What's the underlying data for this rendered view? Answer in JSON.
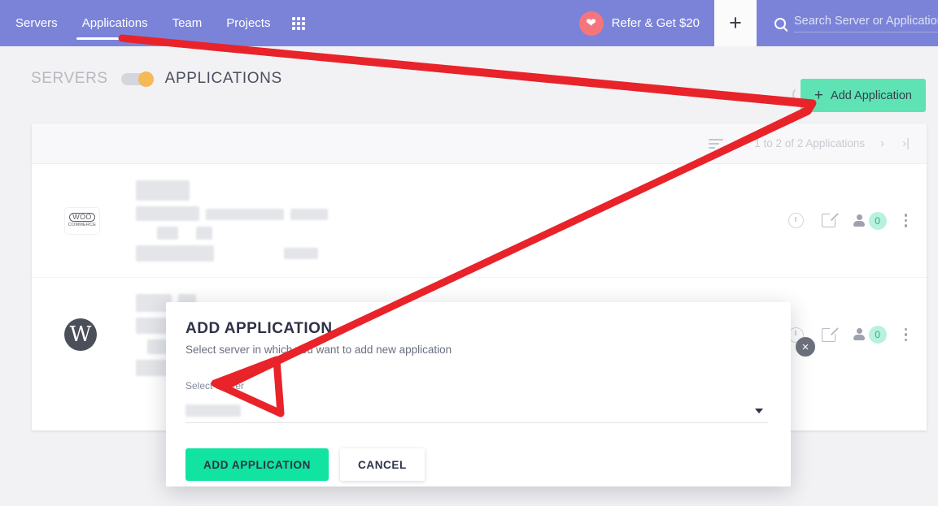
{
  "topnav": {
    "items": [
      {
        "label": "Servers",
        "active": false
      },
      {
        "label": "Applications",
        "active": true
      },
      {
        "label": "Team",
        "active": false
      },
      {
        "label": "Projects",
        "active": false
      }
    ],
    "apps_grid_icon": "grid-apps-icon",
    "refer": {
      "label": "Refer & Get $20",
      "icon": "heart-icon"
    },
    "plus": {
      "label": "+",
      "icon": "plus-icon"
    },
    "search": {
      "icon": "search-icon",
      "placeholder": "Search Server or Application",
      "value": ""
    },
    "colors": {
      "bar": "#7b83d8",
      "text": "#ffffff"
    }
  },
  "breadcrumb": {
    "servers_label": "SERVERS",
    "applications_label": "APPLICATIONS",
    "toggle_icon": "toggle-switch-icon",
    "toggle_state": "applications",
    "toggle_knob_color": "#f5b955"
  },
  "toolbar": {
    "refresh_icon": "refresh-icon",
    "add_application_label": "Add Application",
    "add_application_plus": "+",
    "add_application_color": "#5fe3b4"
  },
  "list": {
    "sort_icon": "sort-filter-icon",
    "page_count_text": "1 to 2 of 2 Applications",
    "next_page_icon": "chevron-right-icon",
    "last_page_icon": "last-page-icon",
    "rows": [
      {
        "logo": "woocommerce-logo",
        "logo_line1": "WOO",
        "logo_line2": "COMMERCE",
        "history_icon": "clock-history-icon",
        "launch_icon": "external-link-icon",
        "user_icon": "user-icon",
        "user_count": "0",
        "menu_icon": "kebab-menu-icon"
      },
      {
        "logo": "wordpress-logo",
        "logo_glyph": "W",
        "history_icon": "clock-history-icon",
        "launch_icon": "external-link-icon",
        "user_icon": "user-icon",
        "user_count": "0",
        "menu_icon": "kebab-menu-icon"
      }
    ]
  },
  "modal": {
    "title": "ADD APPLICATION",
    "subtitle": "Select server in which you want to add new application",
    "field_label": "Select Server",
    "select_value": "",
    "caret_icon": "chevron-down-icon",
    "submit_label": "ADD APPLICATION",
    "cancel_label": "CANCEL",
    "close_icon": "close-icon",
    "close_glyph": "×",
    "submit_color": "#11e3a0"
  },
  "annotation": {
    "type": "arrow",
    "color": "#e8232a",
    "description": "red arrow from top-left to Add Application button then to Select Server field"
  }
}
